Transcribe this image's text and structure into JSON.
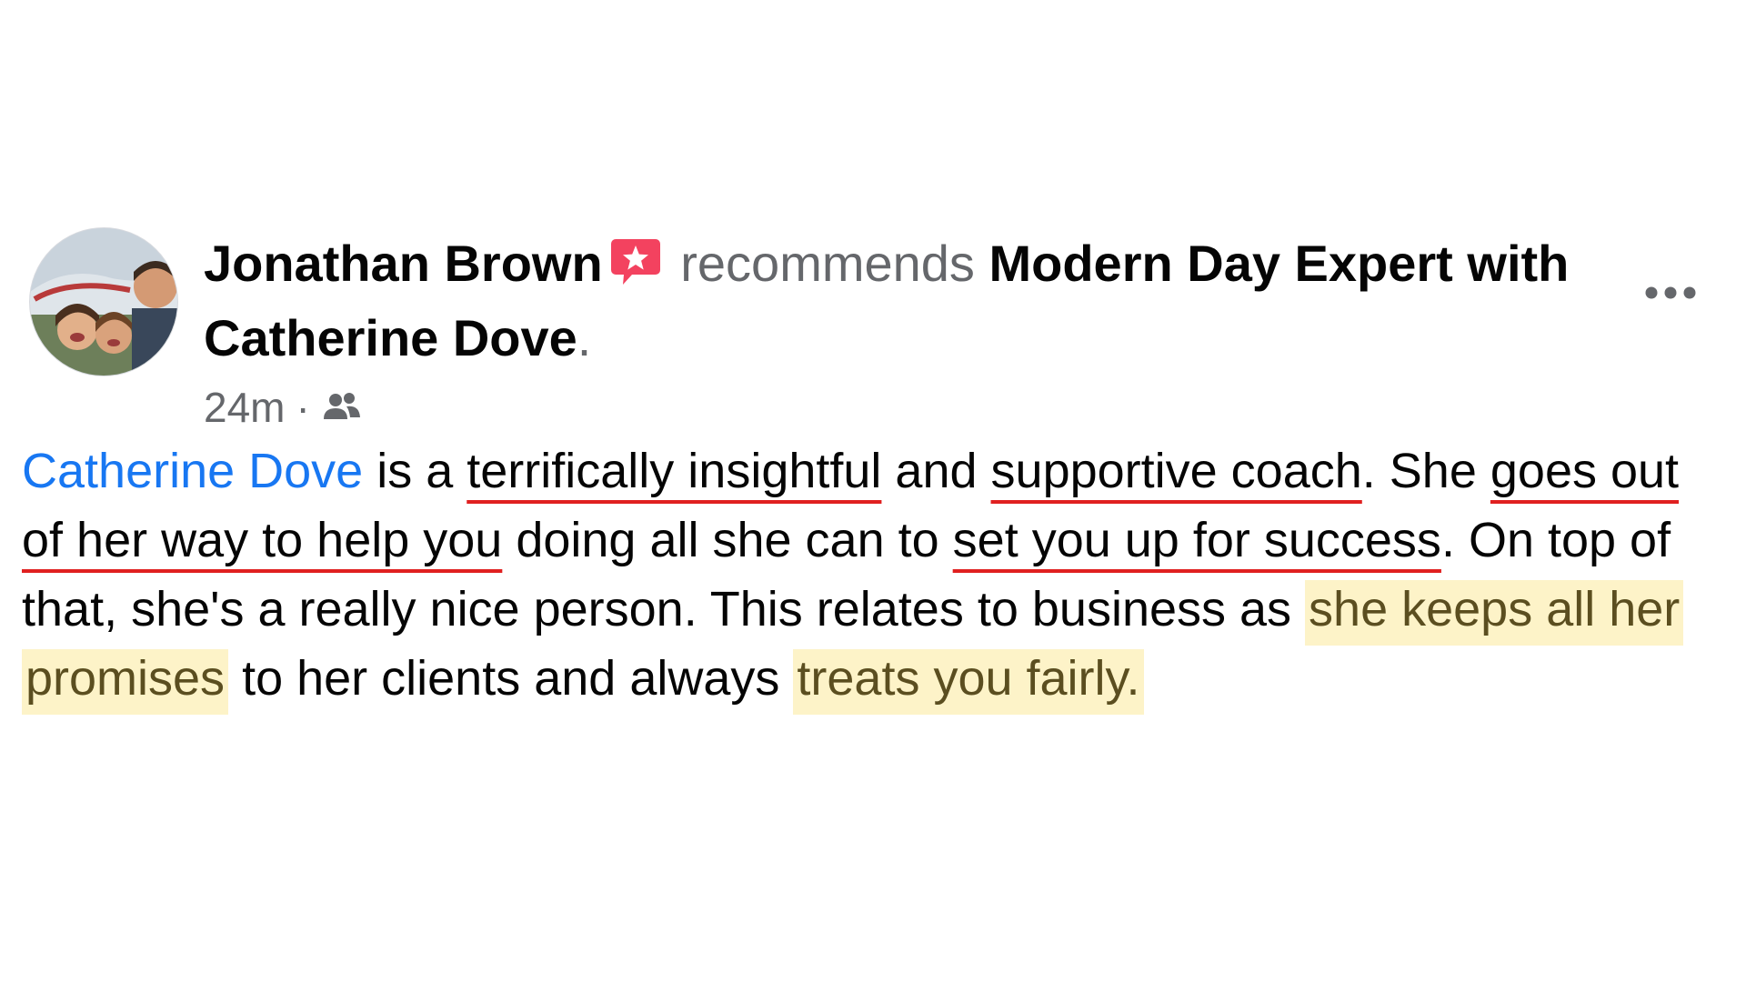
{
  "post": {
    "author_name": "Jonathan Brown",
    "verb": "recommends",
    "page_name": "Modern Day Expert with Catherine Dove",
    "title_period": ".",
    "time_ago": "24m",
    "meta_separator": "·",
    "audience_icon": "friends-audience-icon",
    "recommend_badge_icon": "recommendation-star-bubble-icon",
    "more_icon": "more-options-icon",
    "avatar_icon": "profile-photo-avatar"
  },
  "review": {
    "mention": "Catherine Dove",
    "t1": " is a ",
    "u1": "terrifically insightful",
    "t2": " and ",
    "u2": "supportive coach",
    "t3": ". She ",
    "u3": "goes out of her way to help you",
    "t4": " doing all she can to ",
    "u4": "set you up for success",
    "t5": ". On top of that, she's a really nice person. This relates to business as ",
    "h1": "she keeps all her promises",
    "t6": " to her clients and always ",
    "h2": "treats you fairly."
  },
  "colors": {
    "mention": "#1877f2",
    "underline": "#e02020",
    "highlight_bg": "#fdf3c8",
    "badge": "#f3425f",
    "secondary_text": "#65676b"
  }
}
